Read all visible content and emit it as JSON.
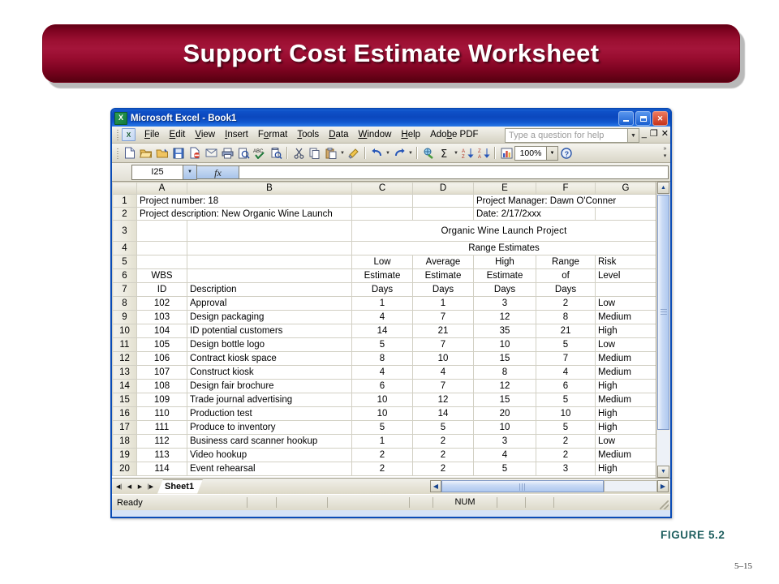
{
  "slide": {
    "title": "Support Cost Estimate Worksheet",
    "figure_label": "FIGURE 5.2",
    "page_number": "5–15",
    "banner_color": "#9b0f31",
    "figure_color": "#1f5f5f"
  },
  "window": {
    "title": "Microsoft Excel - Book1",
    "logo_glyph": "X",
    "caption_buttons": {
      "minimize": "_",
      "maximize": "□",
      "close": "✕"
    }
  },
  "menu": {
    "items": [
      "File",
      "Edit",
      "View",
      "Insert",
      "Format",
      "Tools",
      "Data",
      "Window",
      "Help",
      "Adobe PDF"
    ],
    "ask_placeholder": "Type a question for help",
    "doc_buttons": [
      "_",
      "❐",
      "✕"
    ]
  },
  "toolbar": {
    "icons": [
      "new-document-icon",
      "open-folder-icon",
      "save-as-folder-icon",
      "save-icon",
      "permission-icon",
      "email-icon",
      "print-icon",
      "print-preview-icon",
      "spelling-icon",
      "research-icon",
      "cut-icon",
      "copy-icon",
      "paste-icon",
      "format-painter-icon",
      "undo-icon",
      "redo-icon",
      "insert-hyperlink-icon",
      "autosum-icon",
      "sort-ascending-icon",
      "sort-descending-icon",
      "chart-wizard-icon"
    ],
    "zoom_value": "100%",
    "help_icon": "help-icon"
  },
  "formula_bar": {
    "name_box_value": "I25",
    "fx_label": "fx",
    "formula_value": ""
  },
  "sheet": {
    "column_headers": [
      "A",
      "B",
      "C",
      "D",
      "E",
      "F",
      "G"
    ],
    "rows": [
      {
        "n": "1",
        "height": "small",
        "cells": [
          {
            "t": "Project number: 18",
            "bold": true,
            "span": 2,
            "align": "left"
          },
          {
            "t": "",
            "span": 1
          },
          {
            "t": "",
            "span": 1
          },
          {
            "t": "Project Manager: Dawn O'Conner",
            "bold": true,
            "span": 3,
            "align": "left"
          }
        ]
      },
      {
        "n": "2",
        "height": "small",
        "cells": [
          {
            "t": "Project description: New Organic Wine Launch",
            "bold": true,
            "span": 2,
            "align": "left"
          },
          {
            "t": "",
            "span": 1
          },
          {
            "t": "",
            "span": 1
          },
          {
            "t": "Date: 2/17/2xxx",
            "bold": true,
            "span": 2,
            "align": "left"
          },
          {
            "t": "",
            "span": 1
          }
        ]
      },
      {
        "n": "3",
        "height": "tall",
        "cells": [
          {
            "t": "",
            "span": 1
          },
          {
            "t": "",
            "span": 1
          },
          {
            "t": "Organic Wine Launch Project",
            "span": 5,
            "style": "big-title"
          }
        ]
      },
      {
        "n": "4",
        "height": "std",
        "cells": [
          {
            "t": "",
            "span": 1
          },
          {
            "t": "",
            "span": 1
          },
          {
            "t": "Range Estimates",
            "span": 5,
            "style": "sub-title"
          }
        ]
      },
      {
        "n": "5",
        "height": "std",
        "cells": [
          {
            "t": "",
            "span": 1
          },
          {
            "t": "",
            "span": 1
          },
          {
            "t": "Low",
            "bold": true,
            "align": "center"
          },
          {
            "t": "Average",
            "bold": true,
            "align": "center"
          },
          {
            "t": "High",
            "bold": true,
            "align": "center"
          },
          {
            "t": "Range",
            "bold": true,
            "align": "center"
          },
          {
            "t": "Risk",
            "bold": true,
            "align": "left"
          }
        ]
      },
      {
        "n": "6",
        "height": "std",
        "cells": [
          {
            "t": "WBS",
            "bold": true,
            "align": "center"
          },
          {
            "t": "",
            "span": 1
          },
          {
            "t": "Estimate",
            "bold": true,
            "align": "center"
          },
          {
            "t": "Estimate",
            "bold": true,
            "align": "center"
          },
          {
            "t": "Estimate",
            "bold": true,
            "align": "center"
          },
          {
            "t": "of",
            "bold": true,
            "align": "center"
          },
          {
            "t": "Level",
            "bold": true,
            "align": "left"
          }
        ]
      },
      {
        "n": "7",
        "height": "std",
        "cells": [
          {
            "t": "ID",
            "bold": true,
            "align": "center"
          },
          {
            "t": "Description",
            "bold": true,
            "align": "left"
          },
          {
            "t": "Days",
            "bold": true,
            "align": "center"
          },
          {
            "t": "Days",
            "bold": true,
            "align": "center"
          },
          {
            "t": "Days",
            "bold": true,
            "align": "center"
          },
          {
            "t": "Days",
            "bold": true,
            "align": "center"
          },
          {
            "t": "",
            "align": "left"
          }
        ]
      },
      {
        "n": "8",
        "height": "std",
        "cells": [
          {
            "t": "102",
            "bold": true,
            "align": "center"
          },
          {
            "t": "Approval",
            "bold": true,
            "align": "left"
          },
          {
            "t": "1",
            "bold": true,
            "align": "center"
          },
          {
            "t": "1",
            "bold": true,
            "align": "center"
          },
          {
            "t": "3",
            "bold": true,
            "align": "center"
          },
          {
            "t": "2",
            "bold": true,
            "align": "center"
          },
          {
            "t": "Low",
            "bold": true,
            "align": "left"
          }
        ]
      },
      {
        "n": "9",
        "height": "std",
        "cells": [
          {
            "t": "103",
            "bold": true,
            "align": "center"
          },
          {
            "t": "Design packaging",
            "bold": true,
            "align": "left"
          },
          {
            "t": "4",
            "bold": true,
            "align": "center"
          },
          {
            "t": "7",
            "bold": true,
            "align": "center"
          },
          {
            "t": "12",
            "bold": true,
            "align": "center"
          },
          {
            "t": "8",
            "bold": true,
            "align": "center"
          },
          {
            "t": "Medium",
            "bold": true,
            "align": "left"
          }
        ]
      },
      {
        "n": "10",
        "height": "std",
        "cells": [
          {
            "t": "104",
            "bold": true,
            "align": "center"
          },
          {
            "t": "ID potential customers",
            "bold": true,
            "align": "left"
          },
          {
            "t": "14",
            "bold": true,
            "align": "center"
          },
          {
            "t": "21",
            "bold": true,
            "align": "center"
          },
          {
            "t": "35",
            "bold": true,
            "align": "center"
          },
          {
            "t": "21",
            "bold": true,
            "align": "center"
          },
          {
            "t": "High",
            "bold": true,
            "align": "left"
          }
        ]
      },
      {
        "n": "11",
        "height": "std",
        "cells": [
          {
            "t": "105",
            "bold": true,
            "align": "center"
          },
          {
            "t": "Design bottle logo",
            "bold": true,
            "align": "left"
          },
          {
            "t": "5",
            "bold": true,
            "align": "center"
          },
          {
            "t": "7",
            "bold": true,
            "align": "center"
          },
          {
            "t": "10",
            "bold": true,
            "align": "center"
          },
          {
            "t": "5",
            "bold": true,
            "align": "center"
          },
          {
            "t": "Low",
            "bold": true,
            "align": "left"
          }
        ]
      },
      {
        "n": "12",
        "height": "std",
        "cells": [
          {
            "t": "106",
            "bold": true,
            "align": "center"
          },
          {
            "t": "Contract kiosk space",
            "bold": true,
            "align": "left"
          },
          {
            "t": "8",
            "bold": true,
            "align": "center"
          },
          {
            "t": "10",
            "bold": true,
            "align": "center"
          },
          {
            "t": "15",
            "bold": true,
            "align": "center"
          },
          {
            "t": "7",
            "bold": true,
            "align": "center"
          },
          {
            "t": "Medium",
            "bold": true,
            "align": "left"
          }
        ]
      },
      {
        "n": "13",
        "height": "std",
        "cells": [
          {
            "t": "107",
            "bold": true,
            "align": "center"
          },
          {
            "t": "Construct kiosk",
            "bold": true,
            "align": "left"
          },
          {
            "t": "4",
            "bold": true,
            "align": "center"
          },
          {
            "t": "4",
            "bold": true,
            "align": "center"
          },
          {
            "t": "8",
            "bold": true,
            "align": "center"
          },
          {
            "t": "4",
            "bold": true,
            "align": "center"
          },
          {
            "t": "Medium",
            "bold": true,
            "align": "left"
          }
        ]
      },
      {
        "n": "14",
        "height": "std",
        "cells": [
          {
            "t": "108",
            "bold": true,
            "align": "center"
          },
          {
            "t": "Design fair brochure",
            "bold": true,
            "align": "left"
          },
          {
            "t": "6",
            "bold": true,
            "align": "center"
          },
          {
            "t": "7",
            "bold": true,
            "align": "center"
          },
          {
            "t": "12",
            "bold": true,
            "align": "center"
          },
          {
            "t": "6",
            "bold": true,
            "align": "center"
          },
          {
            "t": "High",
            "bold": true,
            "align": "left"
          }
        ]
      },
      {
        "n": "15",
        "height": "std",
        "cells": [
          {
            "t": "109",
            "bold": true,
            "align": "center"
          },
          {
            "t": "Trade journal advertising",
            "bold": true,
            "align": "left"
          },
          {
            "t": "10",
            "bold": true,
            "align": "center"
          },
          {
            "t": "12",
            "bold": true,
            "align": "center"
          },
          {
            "t": "15",
            "bold": true,
            "align": "center"
          },
          {
            "t": "5",
            "bold": true,
            "align": "center"
          },
          {
            "t": "Medium",
            "bold": true,
            "align": "left"
          }
        ]
      },
      {
        "n": "16",
        "height": "std",
        "cells": [
          {
            "t": "110",
            "bold": true,
            "align": "center"
          },
          {
            "t": "Production test",
            "bold": true,
            "align": "left"
          },
          {
            "t": "10",
            "bold": true,
            "align": "center"
          },
          {
            "t": "14",
            "bold": true,
            "align": "center"
          },
          {
            "t": "20",
            "bold": true,
            "align": "center"
          },
          {
            "t": "10",
            "bold": true,
            "align": "center"
          },
          {
            "t": "High",
            "bold": true,
            "align": "left"
          }
        ]
      },
      {
        "n": "17",
        "height": "std",
        "cells": [
          {
            "t": "111",
            "bold": true,
            "align": "center"
          },
          {
            "t": "Produce to inventory",
            "bold": true,
            "align": "left"
          },
          {
            "t": "5",
            "bold": true,
            "align": "center"
          },
          {
            "t": "5",
            "bold": true,
            "align": "center"
          },
          {
            "t": "10",
            "bold": true,
            "align": "center"
          },
          {
            "t": "5",
            "bold": true,
            "align": "center"
          },
          {
            "t": "High",
            "bold": true,
            "align": "left"
          }
        ]
      },
      {
        "n": "18",
        "height": "std",
        "cells": [
          {
            "t": "112",
            "bold": true,
            "align": "center"
          },
          {
            "t": "Business card scanner hookup",
            "bold": true,
            "align": "left"
          },
          {
            "t": "1",
            "bold": true,
            "align": "center"
          },
          {
            "t": "2",
            "bold": true,
            "align": "center"
          },
          {
            "t": "3",
            "bold": true,
            "align": "center"
          },
          {
            "t": "2",
            "bold": true,
            "align": "center"
          },
          {
            "t": "Low",
            "bold": true,
            "align": "left"
          }
        ]
      },
      {
        "n": "19",
        "height": "std",
        "cells": [
          {
            "t": "113",
            "bold": true,
            "align": "center"
          },
          {
            "t": "Video hookup",
            "bold": true,
            "align": "left"
          },
          {
            "t": "2",
            "bold": true,
            "align": "center"
          },
          {
            "t": "2",
            "bold": true,
            "align": "center"
          },
          {
            "t": "4",
            "bold": true,
            "align": "center"
          },
          {
            "t": "2",
            "bold": true,
            "align": "center"
          },
          {
            "t": "Medium",
            "bold": true,
            "align": "left"
          }
        ]
      },
      {
        "n": "20",
        "height": "std",
        "cells": [
          {
            "t": "114",
            "bold": true,
            "align": "center"
          },
          {
            "t": "Event rehearsal",
            "bold": true,
            "align": "left"
          },
          {
            "t": "2",
            "bold": true,
            "align": "center"
          },
          {
            "t": "2",
            "bold": true,
            "align": "center"
          },
          {
            "t": "5",
            "bold": true,
            "align": "center"
          },
          {
            "t": "3",
            "bold": true,
            "align": "center"
          },
          {
            "t": "High",
            "bold": true,
            "align": "left"
          }
        ]
      }
    ]
  },
  "tabs": {
    "sheets": [
      "Sheet1"
    ],
    "nav": [
      "⧏|",
      "◀",
      "▶",
      "|⧐"
    ]
  },
  "status": {
    "ready": "Ready",
    "num_lock": "NUM"
  }
}
